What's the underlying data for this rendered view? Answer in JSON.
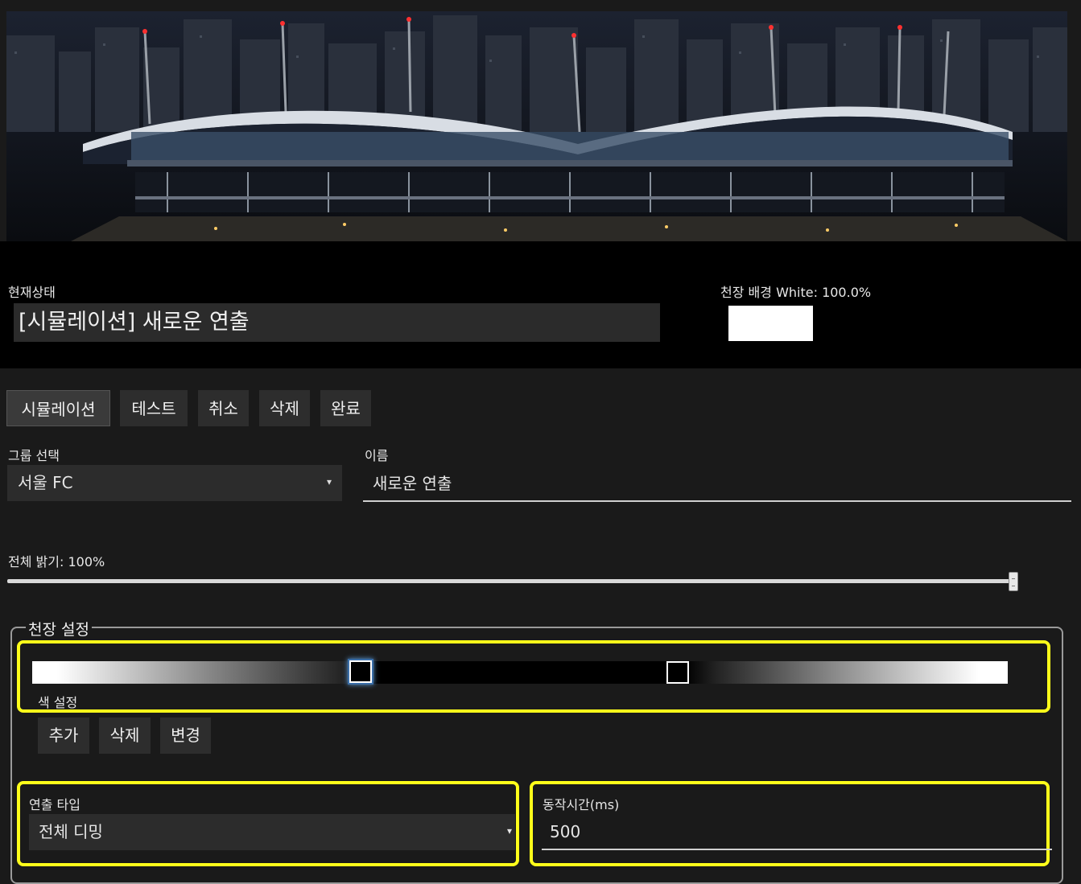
{
  "status": {
    "label": "현재상태",
    "value": "[시뮬레이션] 새로운 연출"
  },
  "ceiling_bg": {
    "label": "천장 배경",
    "value_text": "White: 100.0%",
    "color": "#ffffff"
  },
  "toolbar": {
    "simulation": "시뮬레이션",
    "test": "테스트",
    "cancel": "취소",
    "delete": "삭제",
    "done": "완료"
  },
  "group": {
    "label": "그룹 선택",
    "selected": "서울 FC"
  },
  "name": {
    "label": "이름",
    "value": "새로운 연출"
  },
  "brightness": {
    "label": "전체 밝기",
    "value_text": "100%",
    "level": 1.0
  },
  "ceiling_settings": {
    "legend": "천장 설정",
    "color_label": "색 설정",
    "add": "추가",
    "delete": "삭제",
    "change": "변경",
    "type_label": "연출 타입",
    "type_selected": "전체 디밍",
    "time_label": "동작시간(ms)",
    "time_value": "500"
  },
  "colors": {
    "highlight": "#ffff1a",
    "panel": "#1a1a1a",
    "input": "#2c2c2c"
  },
  "icons": {
    "dropdown": "▾"
  }
}
